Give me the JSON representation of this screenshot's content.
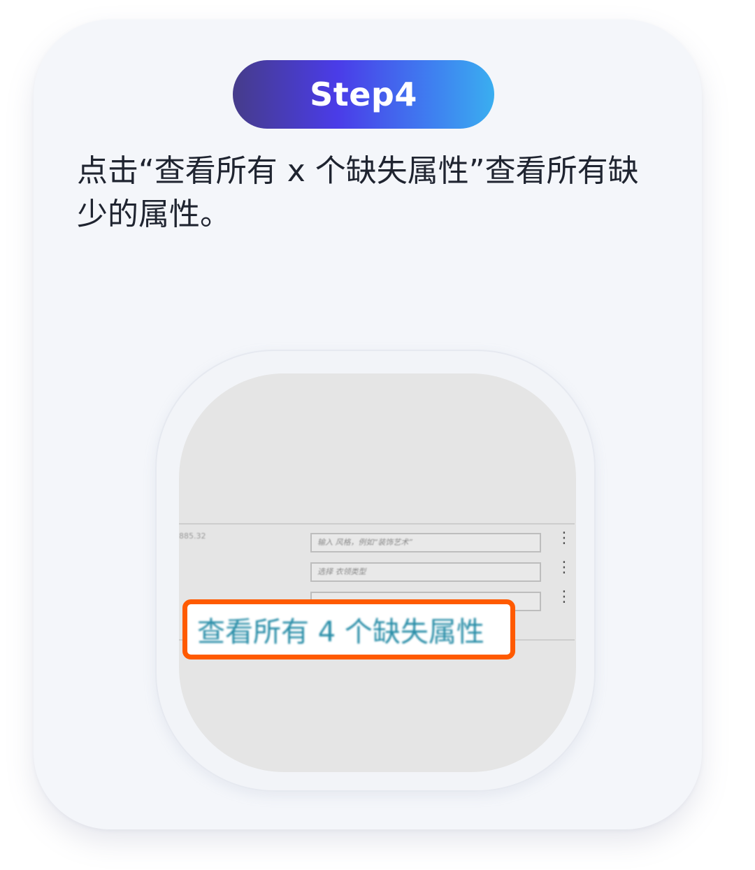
{
  "step": {
    "label": "Step4"
  },
  "description": "点击“查看所有 x 个缺失属性”查看所有缺少的属性。",
  "screenshot": {
    "left_label": "885.32",
    "fields": [
      {
        "placeholder": "输入 风格，例如“装饰艺术”"
      },
      {
        "placeholder": "选择 衣领类型"
      },
      {
        "placeholder": ""
      }
    ],
    "highlight_link": "查看所有 4 个缺失属性",
    "colors": {
      "highlight_border": "#ff5a00",
      "link_text": "#2a8ea8"
    }
  }
}
